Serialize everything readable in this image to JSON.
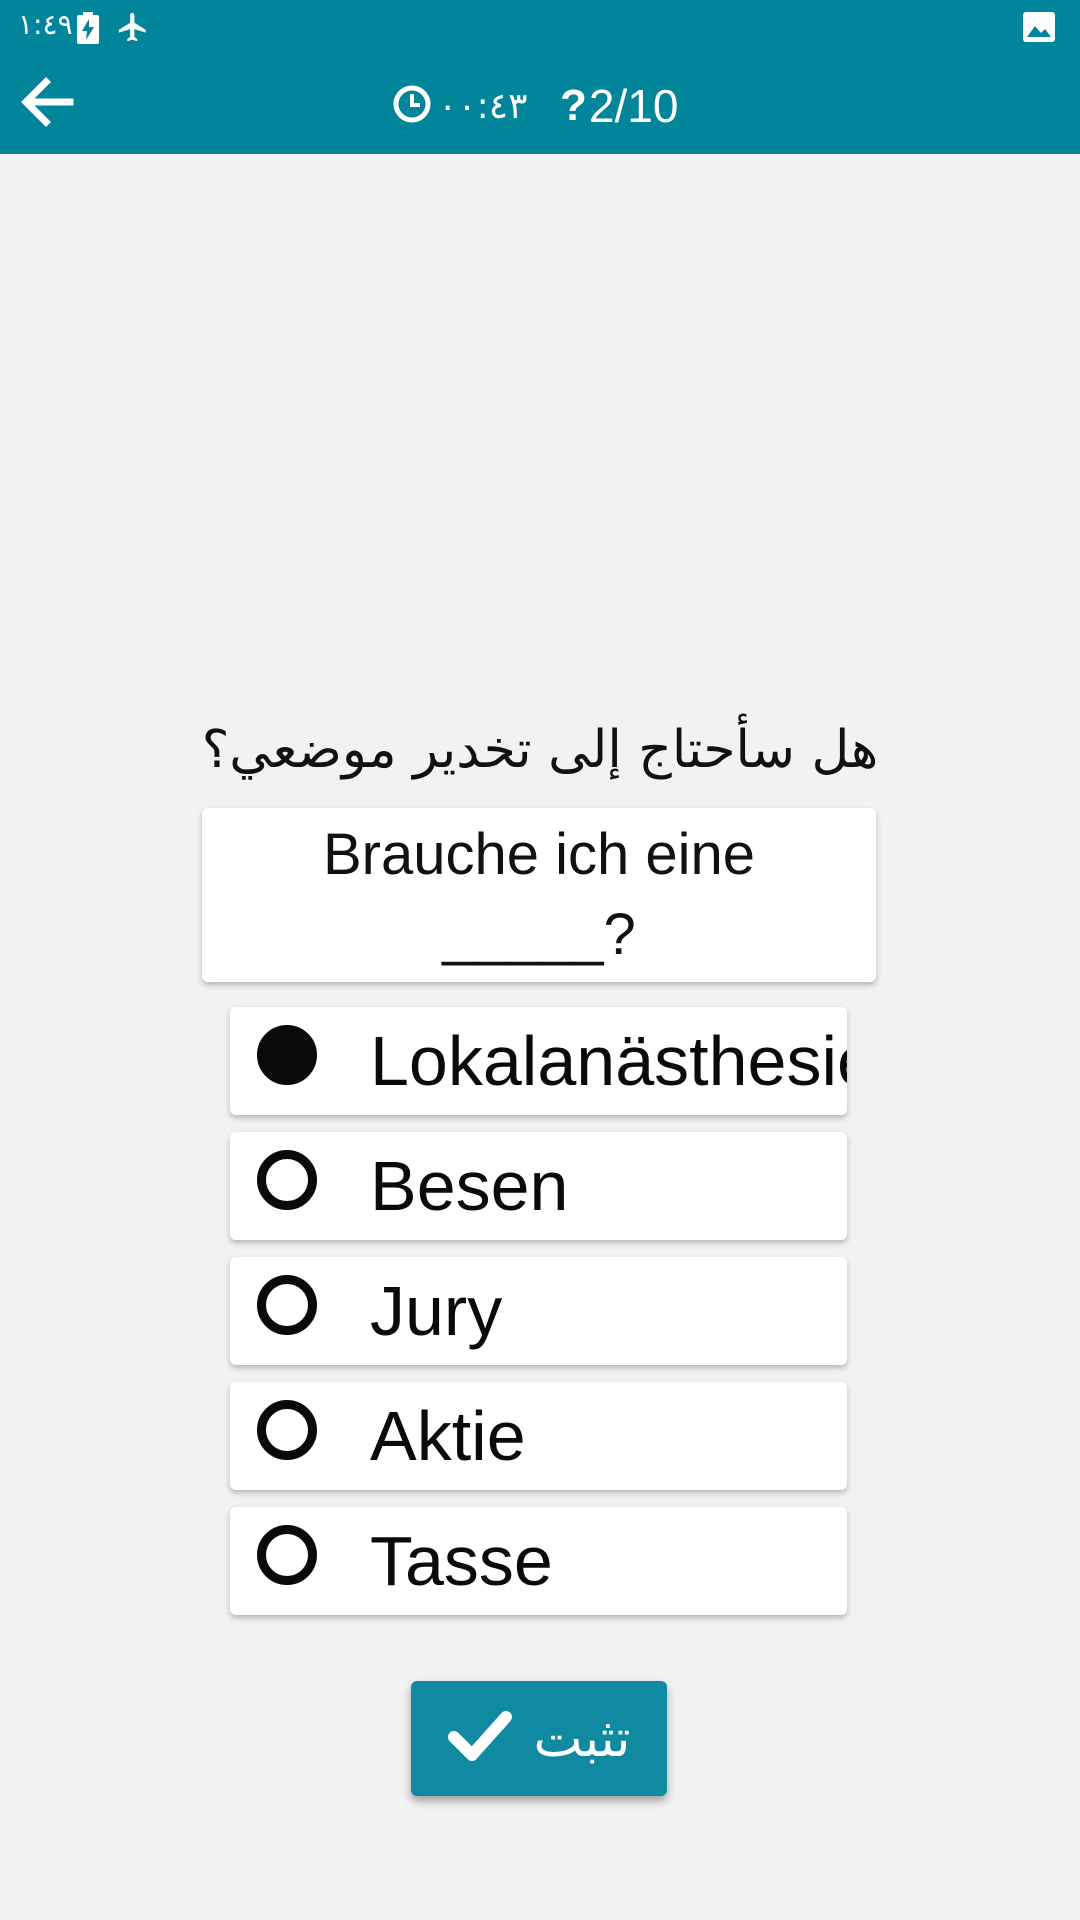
{
  "status_bar": {
    "time": "١:٤٩"
  },
  "header": {
    "timer": "٠٠:٤٣",
    "progress": "2/10"
  },
  "question": {
    "prompt": "هل سأحتاج إلى تخدير موضعي؟",
    "sentence": "Brauche ich eine _____?"
  },
  "options": [
    {
      "label": "Lokalanästhesie",
      "selected": true
    },
    {
      "label": "Besen",
      "selected": false
    },
    {
      "label": "Jury",
      "selected": false
    },
    {
      "label": "Aktie",
      "selected": false
    },
    {
      "label": "Tasse",
      "selected": false
    }
  ],
  "submit": {
    "label": "تثبت"
  },
  "colors": {
    "header_bg": "#00859b",
    "button_bg": "#0f8aa0",
    "page_bg": "#f2f2f2"
  }
}
